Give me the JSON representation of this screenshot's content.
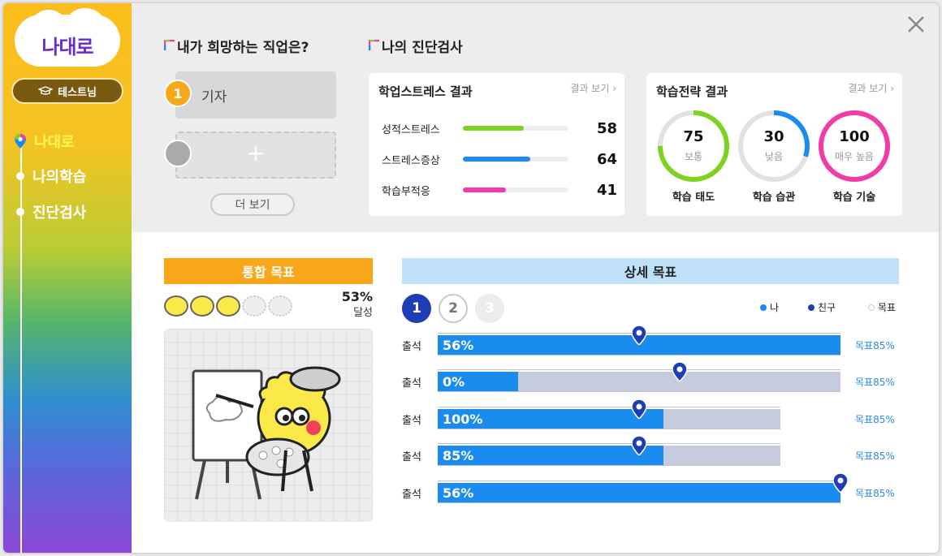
{
  "sidebar": {
    "logo": "나대로",
    "user": "테스트님",
    "items": [
      {
        "label": "나대로",
        "active": true
      },
      {
        "label": "나의학습",
        "active": false
      },
      {
        "label": "진단검사",
        "active": false
      }
    ]
  },
  "jobs": {
    "title": "내가 희망하는 직업은?",
    "first_number": "1",
    "first_job": "기자",
    "add_symbol": "+",
    "more_label": "더 보기"
  },
  "diagnosis": {
    "title": "나의 진단검사",
    "stress": {
      "title": "학업스트레스 결과",
      "link": "결과 보기 ›",
      "rows": [
        {
          "label": "성적스트레스",
          "value": "58",
          "fraction": 0.58,
          "color": "#7ed321"
        },
        {
          "label": "스트레스증상",
          "value": "64",
          "fraction": 0.64,
          "color": "#1a8cf0"
        },
        {
          "label": "학습부적응",
          "value": "41",
          "fraction": 0.41,
          "color": "#f23aa8"
        }
      ]
    },
    "strategy": {
      "title": "학습전략 결과",
      "link": "결과 보기 ›",
      "rings": [
        {
          "value": "75",
          "level": "보통",
          "caption": "학습 태도",
          "fraction": 0.75,
          "color": "#7ed321"
        },
        {
          "value": "30",
          "level": "낮음",
          "caption": "학습 습관",
          "fraction": 0.3,
          "color": "#1a8cf0"
        },
        {
          "value": "100",
          "level": "매우 높음",
          "caption": "학습 기술",
          "fraction": 1.0,
          "color": "#f23aa8"
        }
      ]
    }
  },
  "integrated": {
    "title": "통합 목표",
    "percent": "53%",
    "percent_sub": "달성",
    "faces_filled": 3,
    "faces_total": 5
  },
  "detail": {
    "title": "상세 목표",
    "steps": [
      "1",
      "2",
      "3"
    ],
    "legend": [
      {
        "label": "나",
        "color": "#1a8cf0"
      },
      {
        "label": "친구",
        "color": "#1f3eb5"
      },
      {
        "label": "목표",
        "color": "#e6e6e6"
      }
    ],
    "rows": [
      {
        "label": "출석",
        "value_text": "56%",
        "my_fraction": 1.0,
        "track_fraction": 1.0,
        "friend_fraction": 0.5,
        "target": "목표85%"
      },
      {
        "label": "출석",
        "value_text": "0%",
        "my_fraction": 0.2,
        "track_fraction": 1.0,
        "friend_fraction": 0.6,
        "target": "목표85%"
      },
      {
        "label": "출석",
        "value_text": "100%",
        "my_fraction": 0.56,
        "track_fraction": 0.85,
        "friend_fraction": 0.5,
        "target": "목표85%"
      },
      {
        "label": "출석",
        "value_text": "85%",
        "my_fraction": 0.56,
        "track_fraction": 0.85,
        "friend_fraction": 0.5,
        "target": "목표85%"
      },
      {
        "label": "출석",
        "value_text": "56%",
        "my_fraction": 1.0,
        "track_fraction": 1.0,
        "friend_fraction": 1.0,
        "target": "목표85%"
      }
    ]
  }
}
